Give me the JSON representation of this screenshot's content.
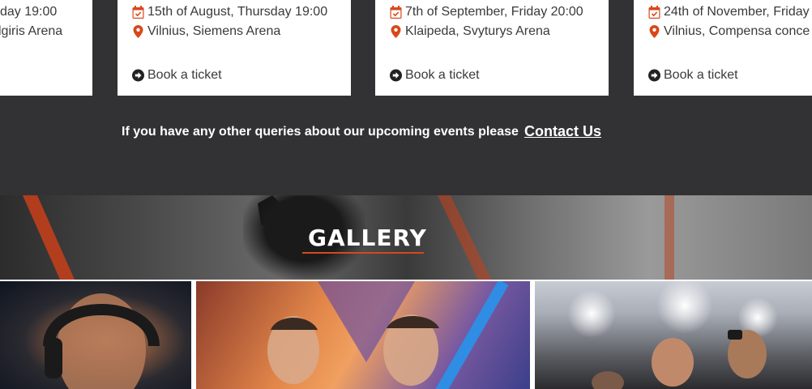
{
  "events": [
    {
      "date": "day 19:00",
      "venue": "lgiris Arena",
      "book": "",
      "partial": true
    },
    {
      "date": "15th of August, Thursday 19:00",
      "venue": "Vilnius, Siemens Arena",
      "book": "Book a ticket"
    },
    {
      "date": "7th of September, Friday 20:00",
      "venue": "Klaipeda, Svyturys Arena",
      "book": "Book a ticket"
    },
    {
      "date": "24th of November, Friday",
      "venue": "Vilnius, Compensa conce",
      "book": "Book a ticket"
    }
  ],
  "queries": {
    "text": "If you have any other queries about our upcoming events please",
    "link": "Contact Us"
  },
  "gallery": {
    "title": "GALLERY"
  },
  "colors": {
    "accent": "#d9481a",
    "band": "#323234",
    "card": "#ffffff"
  },
  "icons": {
    "date": "calendar-check-icon",
    "venue": "map-pin-icon",
    "book": "arrow-circle-right-icon"
  }
}
